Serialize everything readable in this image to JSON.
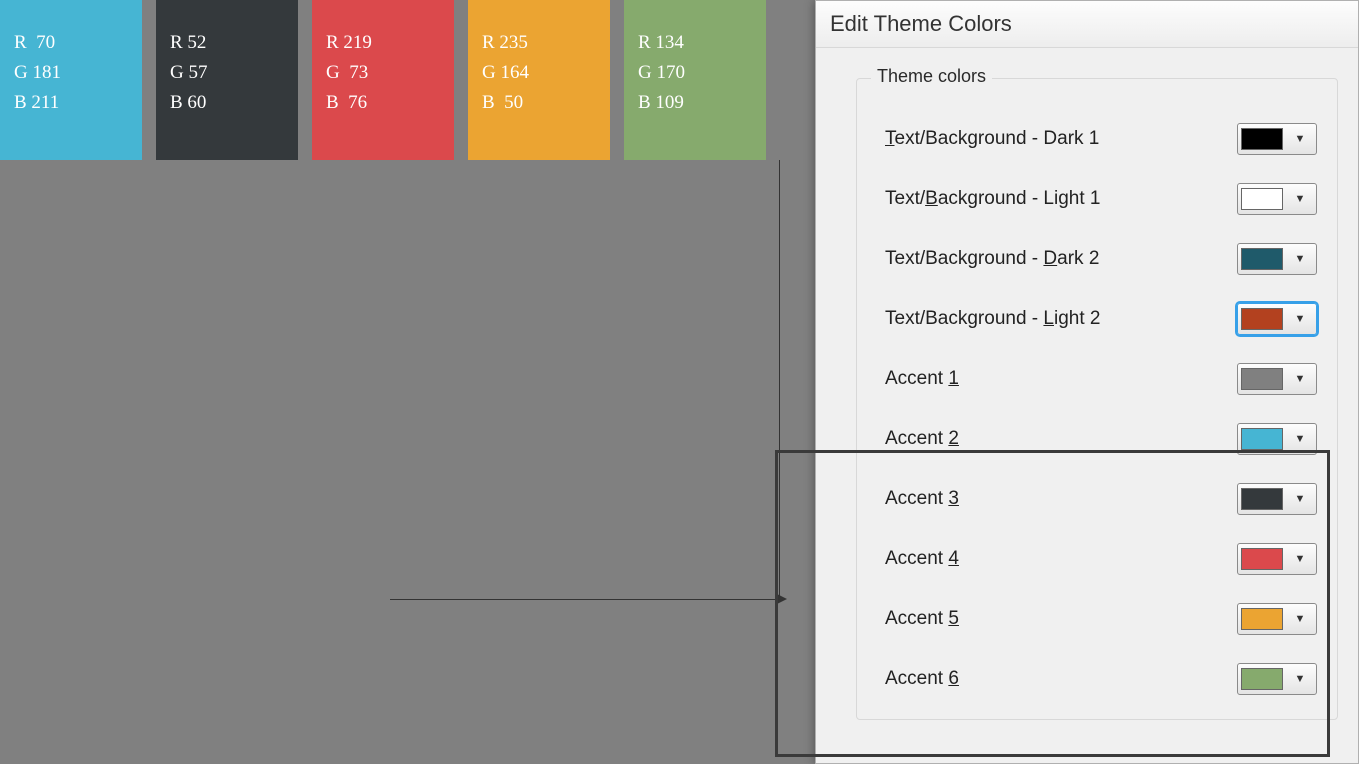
{
  "swatches": [
    {
      "bg": "#46b5d3",
      "r": "R  70",
      "g": "G 181",
      "b": "B 211"
    },
    {
      "bg": "#34393c",
      "r": "R 52",
      "g": "G 57",
      "b": "B 60"
    },
    {
      "bg": "#db494c",
      "r": "R 219",
      "g": "G  73",
      "b": "B  76"
    },
    {
      "bg": "#eba432",
      "r": "R 235",
      "g": "G 164",
      "b": "B  50"
    },
    {
      "bg": "#86aa6d",
      "r": "R 134",
      "g": "G 170",
      "b": "B 109"
    }
  ],
  "dialog": {
    "title": "Edit Theme Colors",
    "legend": "Theme colors",
    "rows": [
      {
        "pre": "",
        "ul": "T",
        "post": "ext/Background - Dark 1",
        "color": "#000000",
        "selected": false
      },
      {
        "pre": "Text/",
        "ul": "B",
        "post": "ackground - Light 1",
        "color": "#ffffff",
        "selected": false
      },
      {
        "pre": "Text/Background - ",
        "ul": "D",
        "post": "ark 2",
        "color": "#1f5a6a",
        "selected": false
      },
      {
        "pre": "Text/Background - ",
        "ul": "L",
        "post": "ight 2",
        "color": "#b3411f",
        "selected": true
      },
      {
        "pre": "Accent ",
        "ul": "1",
        "post": "",
        "color": "#808080",
        "selected": false
      },
      {
        "pre": "Accent ",
        "ul": "2",
        "post": "",
        "color": "#46b5d3",
        "selected": false
      },
      {
        "pre": "Accent ",
        "ul": "3",
        "post": "",
        "color": "#34393c",
        "selected": false
      },
      {
        "pre": "Accent ",
        "ul": "4",
        "post": "",
        "color": "#db494c",
        "selected": false
      },
      {
        "pre": "Accent ",
        "ul": "5",
        "post": "",
        "color": "#eba432",
        "selected": false
      },
      {
        "pre": "Accent ",
        "ul": "6",
        "post": "",
        "color": "#86aa6d",
        "selected": false
      }
    ]
  }
}
